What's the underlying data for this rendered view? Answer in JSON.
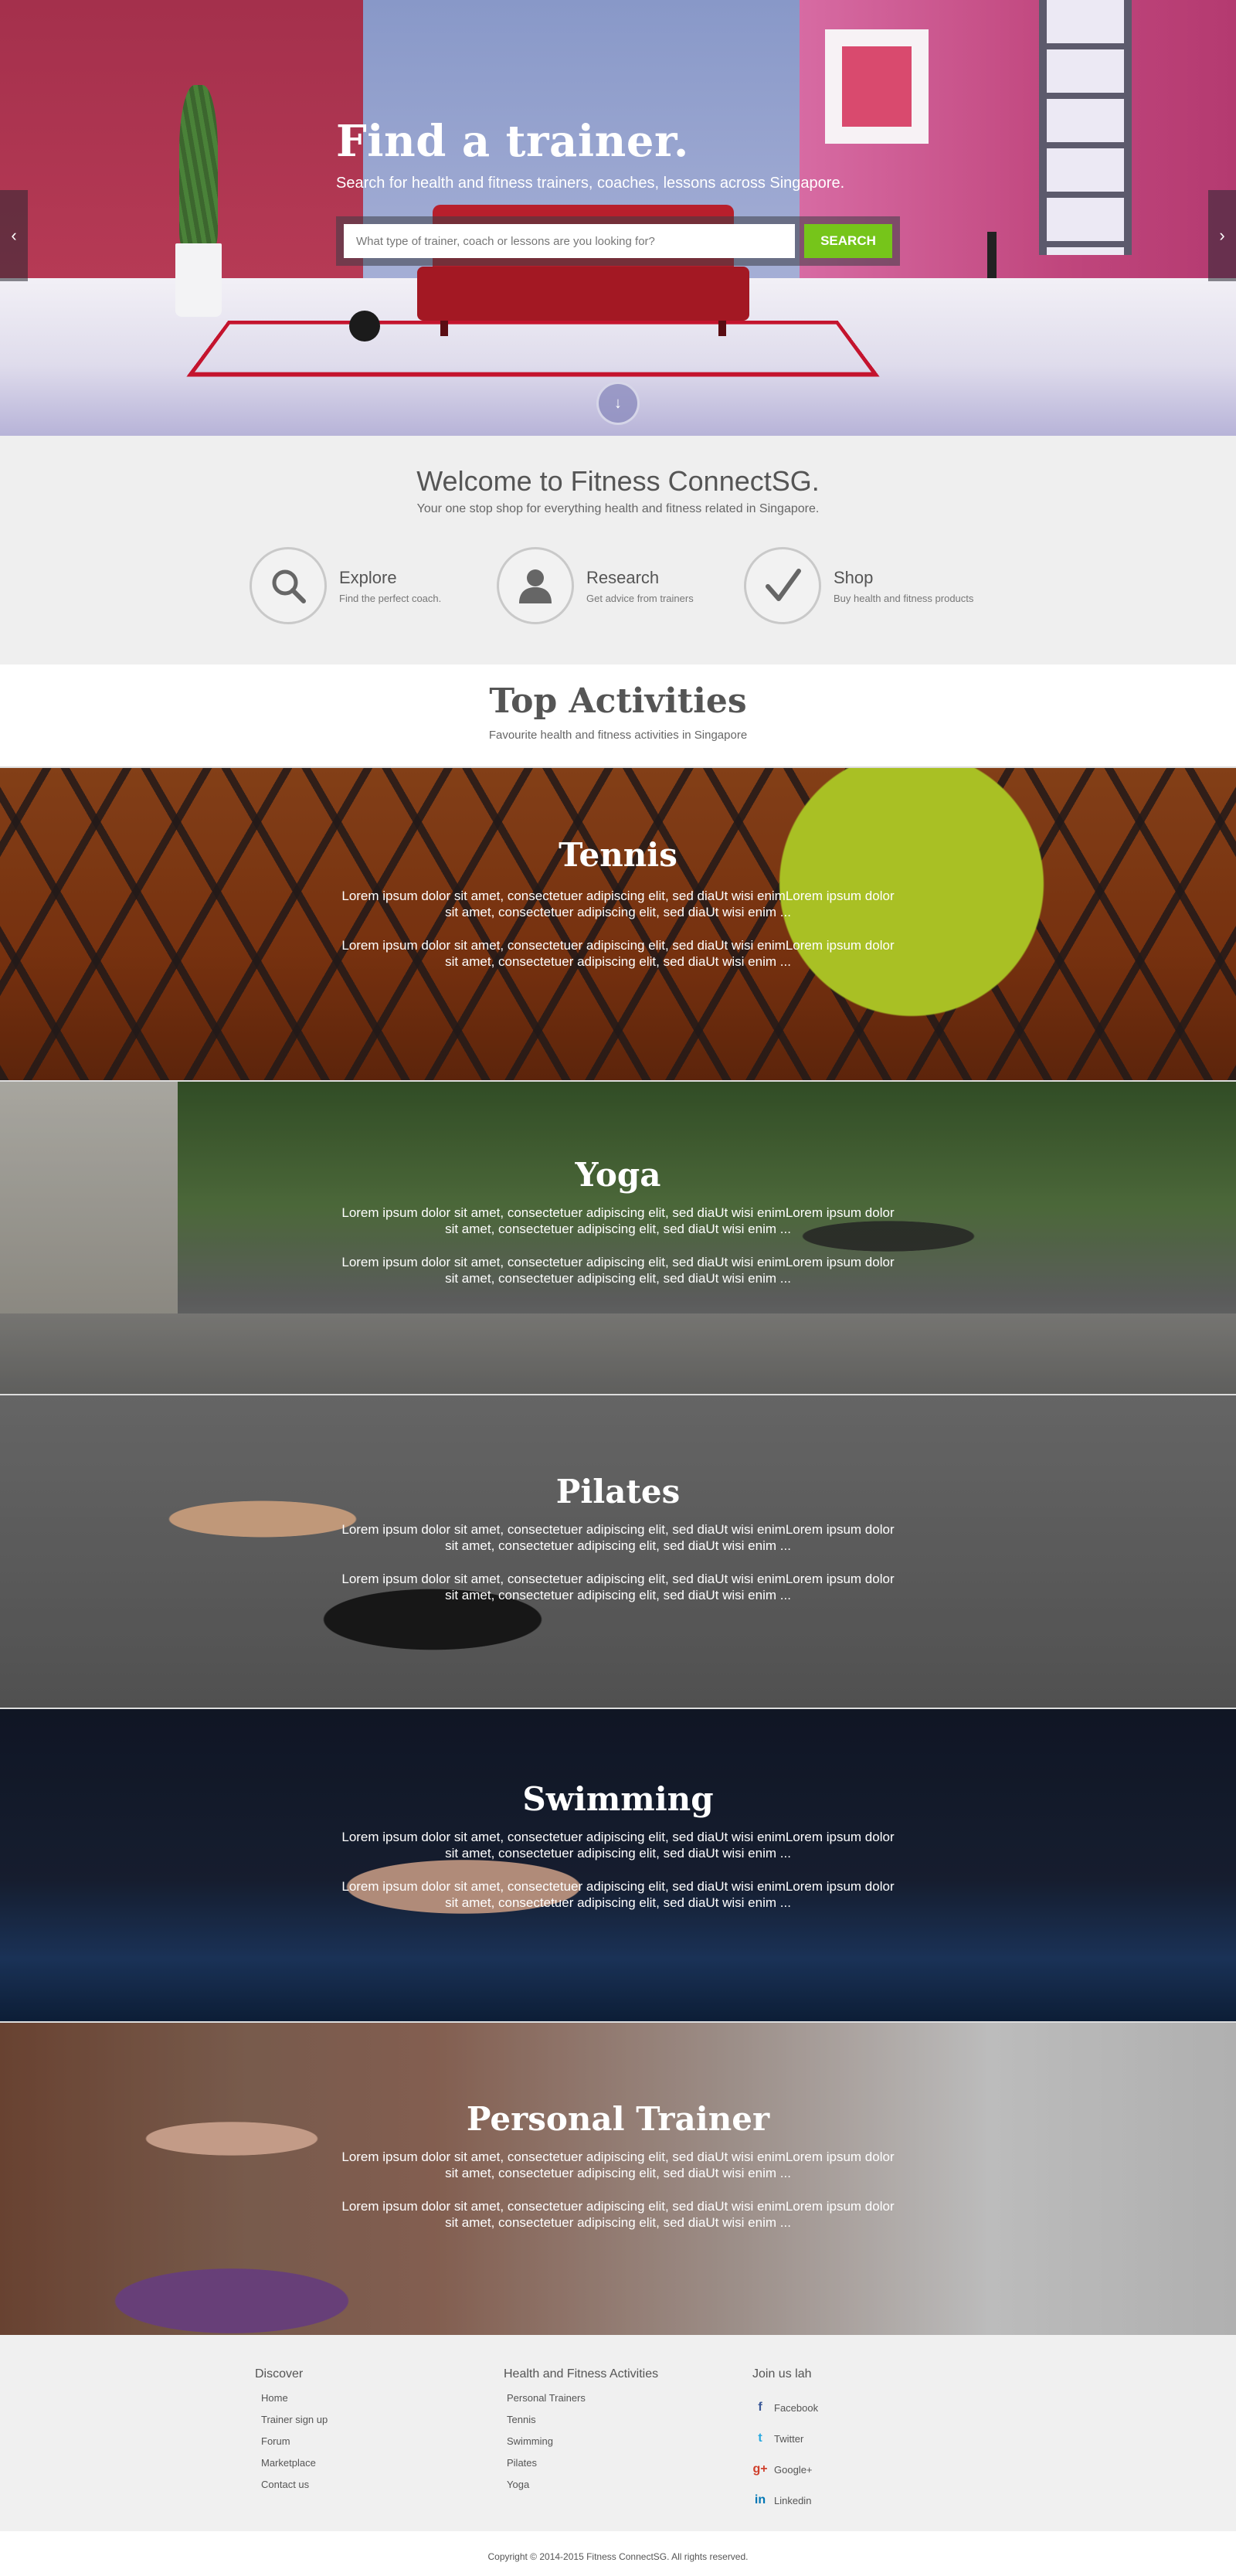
{
  "hero": {
    "title": "Find a trainer.",
    "subtitle": "Search for health and fitness trainers, coaches, lessons across Singapore.",
    "search_placeholder": "What type of trainer, coach or lessons are you looking for?",
    "search_button": "SEARCH",
    "prev_arrow": "‹",
    "next_arrow": "›",
    "scroll_down": "↓"
  },
  "welcome": {
    "title": "Welcome to Fitness ConnectSG.",
    "tagline": "Your one stop shop for everything health and fitness related in Singapore.",
    "features": [
      {
        "icon": "magnifier-icon",
        "title": "Explore",
        "desc": "Find the perfect coach."
      },
      {
        "icon": "person-icon",
        "title": "Research",
        "desc": "Get advice from trainers"
      },
      {
        "icon": "checkmark-icon",
        "title": "Shop",
        "desc": "Buy health and fitness products"
      }
    ]
  },
  "top_activities": {
    "title": "Top Activities",
    "subtitle": "Favourite health and fitness activities in Singapore",
    "items": [
      {
        "name": "Tennis",
        "p1": "Lorem ipsum dolor sit amet, consectetuer adipiscing elit, sed diaUt wisi enimLorem ipsum dolor sit amet, consectetuer adipiscing elit, sed diaUt wisi enim ...",
        "p2": "Lorem ipsum dolor sit amet, consectetuer adipiscing elit, sed diaUt wisi enimLorem ipsum dolor sit amet, consectetuer adipiscing elit, sed diaUt wisi enim ..."
      },
      {
        "name": "Yoga",
        "p1": "Lorem ipsum dolor sit amet, consectetuer adipiscing elit, sed diaUt wisi enimLorem ipsum dolor sit amet, consectetuer adipiscing elit, sed diaUt wisi enim ...",
        "p2": "Lorem ipsum dolor sit amet, consectetuer adipiscing elit, sed diaUt wisi enimLorem ipsum dolor sit amet, consectetuer adipiscing elit, sed diaUt wisi enim ..."
      },
      {
        "name": "Pilates",
        "p1": "Lorem ipsum dolor sit amet, consectetuer adipiscing elit, sed diaUt wisi enimLorem ipsum dolor sit amet, consectetuer adipiscing elit, sed diaUt wisi enim ...",
        "p2": "Lorem ipsum dolor sit amet, consectetuer adipiscing elit, sed diaUt wisi enimLorem ipsum dolor sit amet, consectetuer adipiscing elit, sed diaUt wisi enim ..."
      },
      {
        "name": "Swimming",
        "p1": "Lorem ipsum dolor sit amet, consectetuer adipiscing elit, sed diaUt wisi enimLorem ipsum dolor sit amet, consectetuer adipiscing elit, sed diaUt wisi enim ...",
        "p2": "Lorem ipsum dolor sit amet, consectetuer adipiscing elit, sed diaUt wisi enimLorem ipsum dolor sit amet, consectetuer adipiscing elit, sed diaUt wisi enim ..."
      },
      {
        "name": "Personal Trainer",
        "p1": "Lorem ipsum dolor sit amet, consectetuer adipiscing elit, sed diaUt wisi enimLorem ipsum dolor sit amet, consectetuer adipiscing elit, sed diaUt wisi enim ...",
        "p2": "Lorem ipsum dolor sit amet, consectetuer adipiscing elit, sed diaUt wisi enimLorem ipsum dolor sit amet, consectetuer adipiscing elit, sed diaUt wisi enim ..."
      }
    ]
  },
  "footer": {
    "discover": {
      "heading": "Discover",
      "links": [
        "Home",
        "Trainer sign up",
        "Forum",
        "Marketplace",
        "Contact us"
      ]
    },
    "activities": {
      "heading": "Health and Fitness Activities",
      "links": [
        "Personal Trainers",
        "Tennis",
        "Swimming",
        "Pilates",
        "Yoga"
      ]
    },
    "social": {
      "heading": "Join us lah",
      "links": [
        {
          "label": "Facebook",
          "icon": "facebook-icon",
          "glyph": "f",
          "color": "#3b5998"
        },
        {
          "label": "Twitter",
          "icon": "twitter-icon",
          "glyph": "t",
          "color": "#2aa9e0"
        },
        {
          "label": "Google+",
          "icon": "googleplus-icon",
          "glyph": "g+",
          "color": "#d0402c"
        },
        {
          "label": "Linkedin",
          "icon": "linkedin-icon",
          "glyph": "in",
          "color": "#0077b5"
        }
      ]
    },
    "copyright": "Copyright © 2014-2015 Fitness ConnectSG. All rights reserved."
  },
  "colors": {
    "accent": "#76c51a",
    "text": "#555555",
    "section_bg": "#efefef"
  }
}
